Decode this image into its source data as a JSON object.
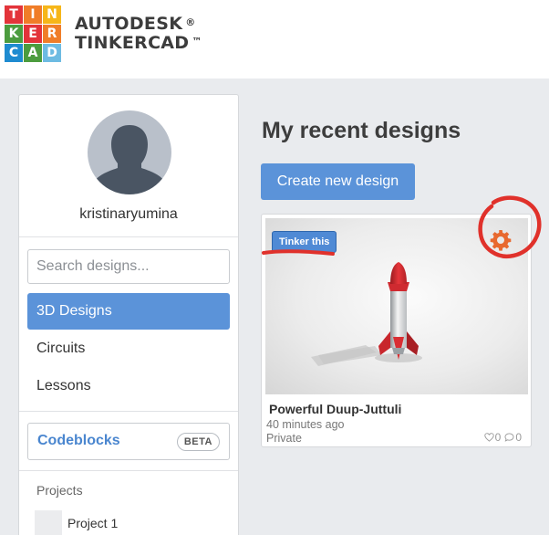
{
  "header": {
    "logo_letters": [
      "T",
      "I",
      "N",
      "K",
      "E",
      "R",
      "C",
      "A",
      "D"
    ],
    "logo_colors": [
      "#e3343a",
      "#f07d28",
      "#f6b619",
      "#4c9c3e",
      "#e3343a",
      "#f07d28",
      "#1e8bd0",
      "#4c9c3e",
      "#6dbbe2"
    ],
    "brand_line1": "AUTODESK",
    "brand_line1_mark": "®",
    "brand_line2": "TINKERCAD",
    "brand_line2_mark": "™"
  },
  "sidebar": {
    "username": "kristinaryumina",
    "search_placeholder": "Search designs...",
    "nav": [
      {
        "label": "3D Designs",
        "active": true
      },
      {
        "label": "Circuits",
        "active": false
      },
      {
        "label": "Lessons",
        "active": false
      }
    ],
    "codeblocks_label": "Codeblocks",
    "beta_badge": "BETA",
    "projects_heading": "Projects",
    "projects": [
      {
        "label": "Project 1"
      }
    ]
  },
  "main": {
    "title": "My recent designs",
    "create_button": "Create new design",
    "designs": [
      {
        "tinker_button": "Tinker this",
        "name": "Powerful Duup-Juttuli",
        "time": "40 minutes ago",
        "privacy": "Private",
        "likes": "0",
        "comments": "0",
        "settings_icon": "gear-icon"
      }
    ]
  },
  "colors": {
    "accent_blue": "#5b93d9",
    "annotation_red": "#e0312b",
    "gear_orange": "#e8692f"
  }
}
